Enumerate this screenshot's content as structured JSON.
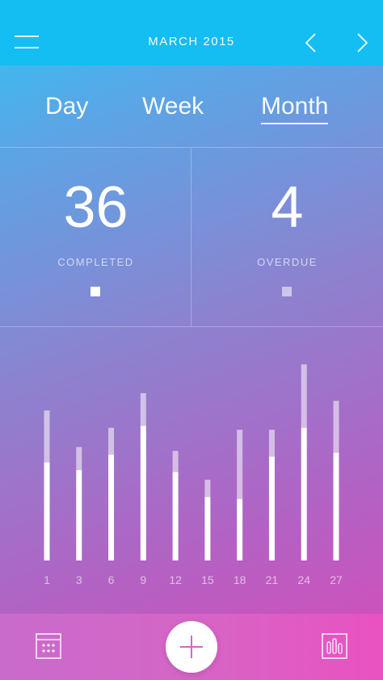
{
  "header": {
    "title": "MARCH 2015",
    "menu_icon": "hamburger-menu-icon",
    "prev_icon": "chevron-left-icon",
    "next_icon": "chevron-right-icon"
  },
  "tabs": [
    {
      "label": "Day",
      "active": false
    },
    {
      "label": "Week",
      "active": false
    },
    {
      "label": "Month",
      "active": true
    }
  ],
  "stats": {
    "completed": {
      "value": "36",
      "label": "COMPLETED"
    },
    "overdue": {
      "value": "4",
      "label": "OVERDUE"
    }
  },
  "colors": {
    "header": "#14bdf2",
    "completed_bar": "#ffffff",
    "overdue_bar": "rgba(255,255,255,0.55)",
    "bottom_bar": "#d565c6"
  },
  "chart_data": {
    "type": "bar",
    "stacked": true,
    "categories": [
      "1",
      "3",
      "6",
      "9",
      "12",
      "15",
      "18",
      "21",
      "24",
      "27"
    ],
    "series": [
      {
        "values": [
          5.1,
          4.7,
          5.5,
          7.0,
          4.6,
          3.3,
          3.2,
          5.4,
          6.9,
          5.6
        ]
      },
      {
        "values": [
          2.7,
          1.2,
          1.4,
          1.7,
          1.1,
          0.9,
          3.6,
          1.4,
          3.3,
          2.7
        ]
      }
    ],
    "ylim": [
      0,
      10.5
    ],
    "grid": false
  },
  "bottom_bar": {
    "calendar_icon": "calendar-icon",
    "add_icon": "plus-icon",
    "stats_icon": "bar-chart-icon"
  }
}
